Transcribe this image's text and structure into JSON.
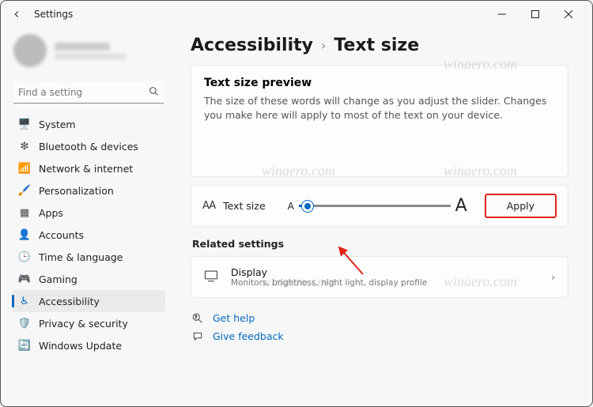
{
  "window": {
    "title": "Settings"
  },
  "search": {
    "placeholder": "Find a setting"
  },
  "sidebar": {
    "items": [
      {
        "label": "System",
        "icon": "🖥️",
        "color": "#0067c0"
      },
      {
        "label": "Bluetooth & devices",
        "icon": "❇",
        "color": "#4a4a4a"
      },
      {
        "label": "Network & internet",
        "icon": "📶",
        "color": "#0067c0"
      },
      {
        "label": "Personalization",
        "icon": "🖌️",
        "color": "#8a5a2a"
      },
      {
        "label": "Apps",
        "icon": "▦",
        "color": "#4a4a4a"
      },
      {
        "label": "Accounts",
        "icon": "👤",
        "color": "#2a8a5a"
      },
      {
        "label": "Time & language",
        "icon": "🕒",
        "color": "#4a4a4a"
      },
      {
        "label": "Gaming",
        "icon": "🎮",
        "color": "#4a4a4a"
      },
      {
        "label": "Accessibility",
        "icon": "♿",
        "color": "#0067c0",
        "active": true
      },
      {
        "label": "Privacy & security",
        "icon": "🛡️",
        "color": "#4a4a4a"
      },
      {
        "label": "Windows Update",
        "icon": "🔄",
        "color": "#0067c0"
      }
    ]
  },
  "breadcrumb": {
    "parent": "Accessibility",
    "current": "Text size"
  },
  "preview": {
    "heading": "Text size preview",
    "body": "The size of these words will change as you adjust the slider. Changes you make here will apply to most of the text on your device."
  },
  "slider": {
    "icon_label": "AA",
    "label": "Text size",
    "minGlyph": "A",
    "maxGlyph": "A",
    "apply": "Apply",
    "value_percent": 6
  },
  "related": {
    "heading": "Related settings",
    "display": {
      "title": "Display",
      "desc": "Monitors, brightness, night light, display profile"
    }
  },
  "help": {
    "get_help": "Get help",
    "feedback": "Give feedback"
  },
  "watermark": "winaero.com",
  "colors": {
    "accent": "#0067c0",
    "highlightBorder": "#e2231a"
  }
}
